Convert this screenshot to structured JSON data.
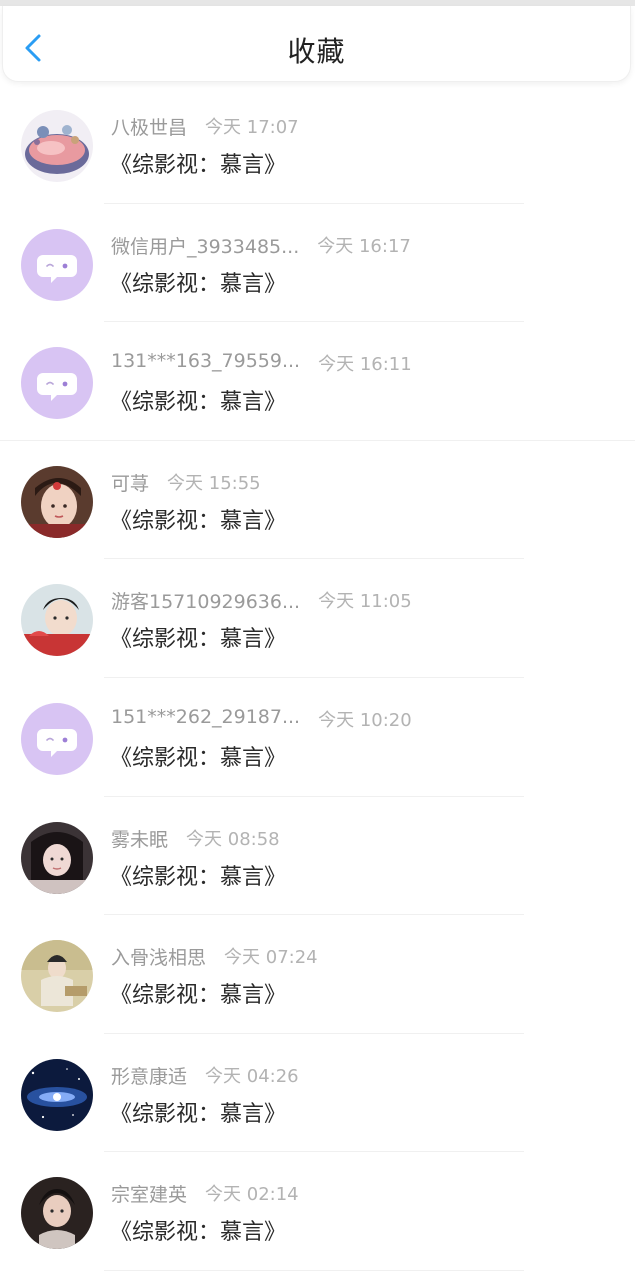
{
  "header": {
    "title": "收藏",
    "back_icon": "chevron-left-icon",
    "accent": "#2a9df4"
  },
  "items": [
    {
      "name": "八极世昌",
      "time": "今天 17:07",
      "book": "《综影视：慕言》",
      "avatar": "photo-food-avatar"
    },
    {
      "name": "微信用户_3933485...",
      "time": "今天 16:17",
      "book": "《综影视：慕言》",
      "avatar": "default-chat-bubble-avatar"
    },
    {
      "name": "131***163_79559...",
      "time": "今天 16:11",
      "book": "《综影视：慕言》",
      "avatar": "default-chat-bubble-avatar"
    },
    {
      "name": "可荨",
      "time": "今天 15:55",
      "book": "《综影视：慕言》",
      "avatar": "photo-portrait-avatar"
    },
    {
      "name": "游客15710929636...",
      "time": "今天 11:05",
      "book": "《综影视：慕言》",
      "avatar": "photo-portrait-avatar"
    },
    {
      "name": "151***262_29187...",
      "time": "今天 10:20",
      "book": "《综影视：慕言》",
      "avatar": "default-chat-bubble-avatar"
    },
    {
      "name": "雾未眠",
      "time": "今天 08:58",
      "book": "《综影视：慕言》",
      "avatar": "photo-portrait-avatar"
    },
    {
      "name": "入骨浅相思",
      "time": "今天 07:24",
      "book": "《综影视：慕言》",
      "avatar": "photo-portrait-avatar"
    },
    {
      "name": "形意康适",
      "time": "今天 04:26",
      "book": "《综影视：慕言》",
      "avatar": "photo-galaxy-avatar"
    },
    {
      "name": "宗室建英",
      "time": "今天 02:14",
      "book": "《综影视：慕言》",
      "avatar": "photo-portrait-avatar"
    }
  ],
  "colors": {
    "default_avatar_bg": "#d8c4f3",
    "name_text": "#9a9a9a",
    "time_text": "#b3b3b3",
    "book_text": "#2a2a2a"
  }
}
